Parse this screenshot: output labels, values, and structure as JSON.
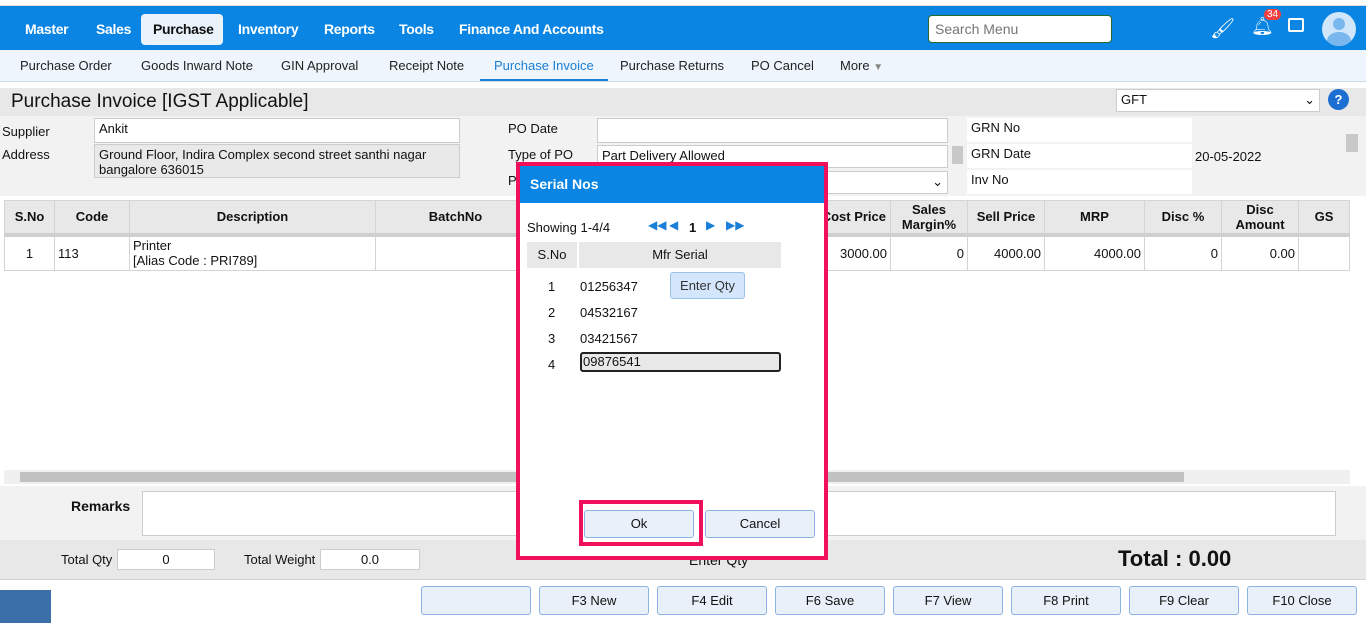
{
  "topnav": {
    "items": [
      "Master",
      "Sales",
      "Purchase",
      "Inventory",
      "Reports",
      "Tools",
      "Finance And Accounts"
    ],
    "active": "Purchase",
    "search_placeholder": "Search Menu",
    "notification_count": "34",
    "brand_color": "#0a85e3"
  },
  "subnav": {
    "items": [
      "Purchase Order",
      "Goods Inward Note",
      "GIN Approval",
      "Receipt Note",
      "Purchase Invoice",
      "Purchase Returns",
      "PO Cancel",
      "More"
    ],
    "active": "Purchase Invoice"
  },
  "page": {
    "title": "Purchase Invoice [IGST Applicable]",
    "branch_select": "GFT"
  },
  "form": {
    "supplier_label": "Supplier",
    "supplier": "Ankit",
    "address_label": "Address",
    "address": "Ground Floor, Indira Complex second street santhi nagar bangalore 636015",
    "po_date_label": "PO Date",
    "po_date": "",
    "type_of_po_label": "Type of PO",
    "type_of_po": "Part Delivery Allowed",
    "third_label": "P",
    "grn_no_label": "GRN No",
    "grn_no": "",
    "grn_date_label": "GRN Date",
    "grn_date": "20-05-2022",
    "inv_no_label": "Inv No",
    "inv_no": ""
  },
  "grid": {
    "columns": [
      "S.No",
      "Code",
      "Description",
      "BatchNo",
      "Cost Price",
      "Sales Margin%",
      "Sell Price",
      "MRP",
      "Disc %",
      "Disc Amount",
      "GS"
    ],
    "rows": [
      {
        "sno": "1",
        "code": "113",
        "desc": "Printer",
        "alias": "[Alias Code : PRI789]",
        "batch": "",
        "cost": "3000.00",
        "margin": "0",
        "sell": "4000.00",
        "mrp": "4000.00",
        "disc": "0",
        "disc_amt": "0.00"
      }
    ]
  },
  "remarks_label": "Remarks",
  "totals": {
    "qty_label": "Total Qty",
    "qty": "0",
    "weight_label": "Total Weight",
    "weight": "0.0",
    "enter_qty": "Enter Qty",
    "total": "Total : 0.00"
  },
  "buttons": [
    "",
    "F3 New",
    "F4 Edit",
    "F6 Save",
    "F7 View",
    "F8 Print",
    "F9 Clear",
    "F10 Close"
  ],
  "modal": {
    "title": "Serial Nos",
    "showing": "Showing 1-4/4",
    "page": "1",
    "columns": [
      "S.No",
      "Mfr Serial"
    ],
    "rows": [
      {
        "sno": "1",
        "serial": "01256347"
      },
      {
        "sno": "2",
        "serial": "04532167"
      },
      {
        "sno": "3",
        "serial": "03421567"
      },
      {
        "sno": "4",
        "serial": "09876541"
      }
    ],
    "tooltip": "Enter Qty",
    "ok": "Ok",
    "cancel": "Cancel",
    "highlight_color": "#f0115a"
  }
}
